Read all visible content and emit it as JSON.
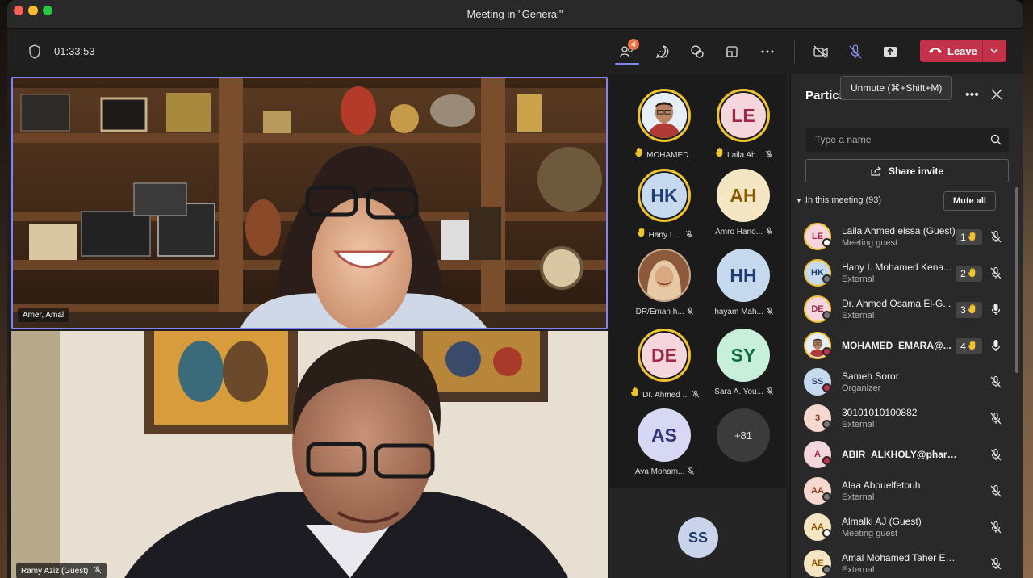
{
  "window": {
    "title": "Meeting in \"General\""
  },
  "toolbar": {
    "timer": "01:33:53",
    "people_badge": "4",
    "leave_label": "Leave"
  },
  "tooltip": "Unmute (⌘+Shift+M)",
  "videos": [
    {
      "name": "Amer, Amal"
    },
    {
      "name": "Ramy Aziz (Guest)"
    }
  ],
  "grid": {
    "tiles": [
      {
        "initials": "",
        "name": "MOHAMED...",
        "hand": true,
        "muted": false,
        "bg": "#dfe9f5",
        "fg": "#333"
      },
      {
        "initials": "LE",
        "name": "Laila Ah...",
        "hand": true,
        "muted": true,
        "bg": "#f5d6dc",
        "fg": "#a02846"
      },
      {
        "initials": "HK",
        "name": "Hany I. ...",
        "hand": true,
        "muted": true,
        "bg": "#c7d9ef",
        "fg": "#1f3d6e"
      },
      {
        "initials": "AH",
        "name": "Amro Hano...",
        "hand": false,
        "muted": true,
        "bg": "#f5e6c3",
        "fg": "#8a5a00"
      },
      {
        "initials": "",
        "name": "DR/Eman h...",
        "hand": false,
        "muted": true,
        "bg": "#caa68c",
        "fg": "#333"
      },
      {
        "initials": "HH",
        "name": "hayam Mah...",
        "hand": false,
        "muted": true,
        "bg": "#c7d9ef",
        "fg": "#1f3d6e"
      },
      {
        "initials": "DE",
        "name": "Dr. Ahmed ...",
        "hand": true,
        "muted": true,
        "bg": "#f5d6dc",
        "fg": "#a02846"
      },
      {
        "initials": "SY",
        "name": "Sara A. You...",
        "hand": false,
        "muted": true,
        "bg": "#c8efd9",
        "fg": "#0e6b3c"
      },
      {
        "initials": "AS",
        "name": "Aya Moham...",
        "hand": false,
        "muted": true,
        "bg": "#d6d8f4",
        "fg": "#33347a"
      },
      {
        "initials": "+81",
        "name": "",
        "hand": false,
        "muted": false,
        "bg": "#3b3b3b",
        "fg": "#ddd"
      }
    ],
    "bottom_avatar": "SS"
  },
  "panel": {
    "title": "Partici",
    "search_placeholder": "Type a name",
    "share_label": "Share invite",
    "in_meeting": "In this meeting (93)",
    "mute_all": "Mute all",
    "participants": [
      {
        "initials": "LE",
        "name": "Laila Ahmed eissa (Guest)",
        "sub": "Meeting guest",
        "hand": "1",
        "mic": "muted",
        "bg": "#f5d6dc",
        "fg": "#a02846",
        "status": "#fff",
        "photo": false
      },
      {
        "initials": "HK",
        "name": "Hany I. Mohamed Kena...",
        "sub": "External",
        "hand": "2",
        "mic": "muted",
        "bg": "#c7d9ef",
        "fg": "#1f3d6e",
        "status": "#777",
        "photo": false
      },
      {
        "initials": "DE",
        "name": "Dr. Ahmed Osama El-G...",
        "sub": "External",
        "hand": "3",
        "mic": "on",
        "bg": "#f5d6dc",
        "fg": "#a02846",
        "status": "#777",
        "photo": false
      },
      {
        "initials": "",
        "name": "MOHAMED_EMARA@...",
        "sub": "",
        "hand": "4",
        "mic": "on",
        "bg": "#dfe9f5",
        "fg": "#333",
        "status": "#c4314b",
        "photo": true
      },
      {
        "initials": "SS",
        "name": "Sameh Soror",
        "sub": "Organizer",
        "hand": "",
        "mic": "muted",
        "bg": "#c7d9ef",
        "fg": "#1f3d6e",
        "status": "#c4314b",
        "photo": false
      },
      {
        "initials": "3",
        "name": "30101010100882",
        "sub": "External",
        "hand": "",
        "mic": "muted",
        "bg": "#f7d8ce",
        "fg": "#8a3a1f",
        "status": "#777",
        "photo": false
      },
      {
        "initials": "A",
        "name": "ABIR_ALKHOLY@pharm.helw...",
        "sub": "",
        "hand": "",
        "mic": "muted",
        "bg": "#f5d6dc",
        "fg": "#a02846",
        "status": "#c4314b",
        "photo": false
      },
      {
        "initials": "AA",
        "name": "Alaa Abouelfetouh",
        "sub": "External",
        "hand": "",
        "mic": "muted",
        "bg": "#f7d8ce",
        "fg": "#8a3a1f",
        "status": "#777",
        "photo": false
      },
      {
        "initials": "AA",
        "name": "Almalki AJ (Guest)",
        "sub": "Meeting guest",
        "hand": "",
        "mic": "muted",
        "bg": "#f5e6c3",
        "fg": "#8a5a00",
        "status": "#fff",
        "photo": false
      },
      {
        "initials": "AE",
        "name": "Amal Mohamed Taher El-sha...",
        "sub": "External",
        "hand": "",
        "mic": "muted",
        "bg": "#f5e6c3",
        "fg": "#8a5a00",
        "status": "#777",
        "photo": false
      }
    ]
  }
}
